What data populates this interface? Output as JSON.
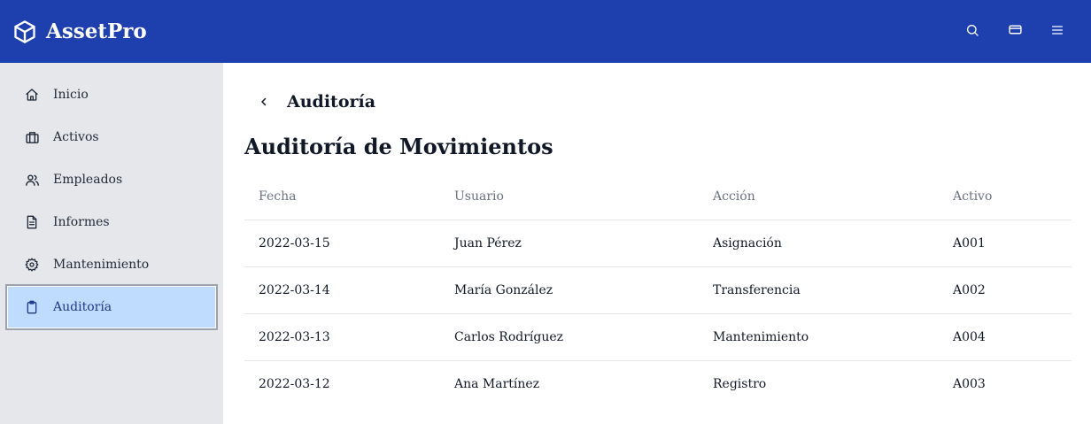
{
  "app": {
    "name": "AssetPro",
    "logo_icon": "cube-icon",
    "brand_color": "#1e40af",
    "top_actions": [
      {
        "icon": "search-icon"
      },
      {
        "icon": "card-icon"
      },
      {
        "icon": "menu-icon"
      }
    ]
  },
  "sidebar": {
    "items": [
      {
        "label": "Inicio",
        "icon": "home-icon",
        "active": false
      },
      {
        "label": "Activos",
        "icon": "briefcase-icon",
        "active": false
      },
      {
        "label": "Empleados",
        "icon": "users-icon",
        "active": false
      },
      {
        "label": "Informes",
        "icon": "document-icon",
        "active": false
      },
      {
        "label": "Mantenimiento",
        "icon": "gear-icon",
        "active": false
      },
      {
        "label": "Auditoría",
        "icon": "clipboard-icon",
        "active": true
      }
    ],
    "active_color": "#bfdbfe"
  },
  "main": {
    "breadcrumb_title": "Auditoría",
    "page_title": "Auditoría de Movimientos",
    "table": {
      "columns": [
        "Fecha",
        "Usuario",
        "Acción",
        "Activo"
      ],
      "rows": [
        [
          "2022-03-15",
          "Juan Pérez",
          "Asignación",
          "A001"
        ],
        [
          "2022-03-14",
          "María González",
          "Transferencia",
          "A002"
        ],
        [
          "2022-03-13",
          "Carlos Rodríguez",
          "Mantenimiento",
          "A004"
        ],
        [
          "2022-03-12",
          "Ana Martínez",
          "Registro",
          "A003"
        ]
      ]
    }
  }
}
